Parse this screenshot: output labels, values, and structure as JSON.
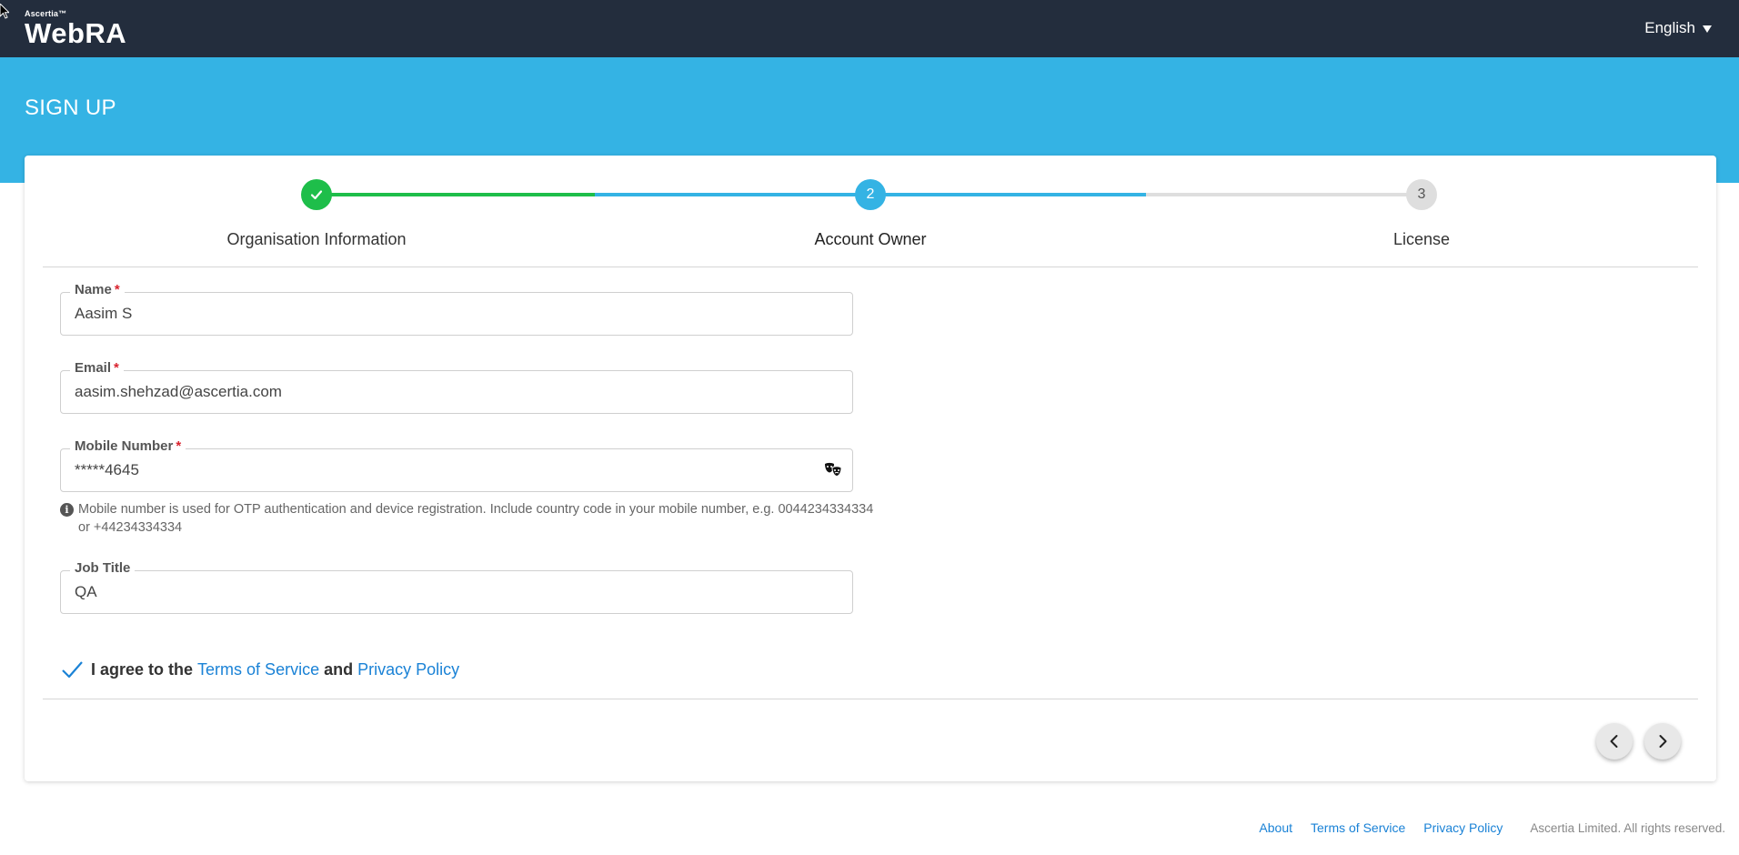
{
  "header": {
    "brand": "Ascertia™",
    "product": "WebRA",
    "language": "English"
  },
  "banner": {
    "title": "SIGN UP"
  },
  "stepper": {
    "steps": [
      {
        "number": "1",
        "label": "Organisation Information",
        "state": "complete"
      },
      {
        "number": "2",
        "label": "Account Owner",
        "state": "active"
      },
      {
        "number": "3",
        "label": "License",
        "state": "pending"
      }
    ]
  },
  "form": {
    "name": {
      "label": "Name",
      "required": "*",
      "value": "Aasim S"
    },
    "email": {
      "label": "Email",
      "required": "*",
      "value": "aasim.shehzad@ascertia.com"
    },
    "mobile": {
      "label": "Mobile Number",
      "required": "*",
      "value": "*****4645",
      "hint": "Mobile number is used for OTP authentication and device registration. Include country code in your mobile number, e.g. 0044234334334 or +44234334334"
    },
    "job_title": {
      "label": "Job Title",
      "value": "QA"
    },
    "agree": {
      "prefix": "I agree to the",
      "terms_link": "Terms of Service",
      "and": "and",
      "privacy_link": "Privacy Policy",
      "checked": true
    }
  },
  "footer": {
    "about": "About",
    "terms": "Terms of Service",
    "privacy": "Privacy Policy",
    "copyright": "Ascertia Limited. All rights reserved."
  },
  "colors": {
    "topbar": "#232d3d",
    "banner": "#34b3e4",
    "complete": "#1ebe4a",
    "active": "#34b3e4",
    "pending": "#dedede",
    "link": "#1a82d6"
  }
}
